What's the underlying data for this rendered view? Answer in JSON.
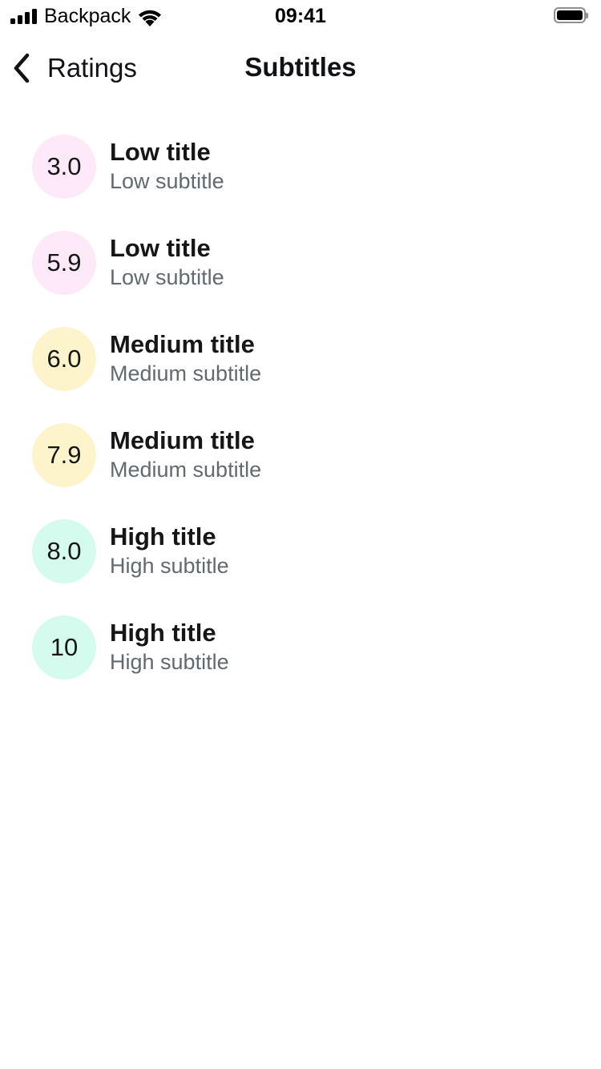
{
  "status_bar": {
    "carrier": "Backpack",
    "time": "09:41"
  },
  "nav": {
    "back_label": "Ratings",
    "title": "Subtitles"
  },
  "ratings": [
    {
      "value": "3.0",
      "level": "low",
      "title": "Low title",
      "subtitle": "Low subtitle"
    },
    {
      "value": "5.9",
      "level": "low",
      "title": "Low title",
      "subtitle": "Low subtitle"
    },
    {
      "value": "6.0",
      "level": "medium",
      "title": "Medium title",
      "subtitle": "Medium subtitle"
    },
    {
      "value": "7.9",
      "level": "medium",
      "title": "Medium title",
      "subtitle": "Medium subtitle"
    },
    {
      "value": "8.0",
      "level": "high",
      "title": "High title",
      "subtitle": "High subtitle"
    },
    {
      "value": "10",
      "level": "high",
      "title": "High title",
      "subtitle": "High subtitle"
    }
  ],
  "colors": {
    "low": "#fde9f7",
    "medium": "#fef4cc",
    "high": "#d5fbee",
    "text_primary": "#161616",
    "text_secondary": "#626971"
  },
  "icons": {
    "signal": "cellular-signal-icon",
    "wifi": "wifi-icon",
    "battery": "battery-icon",
    "back": "chevron-left-icon"
  }
}
